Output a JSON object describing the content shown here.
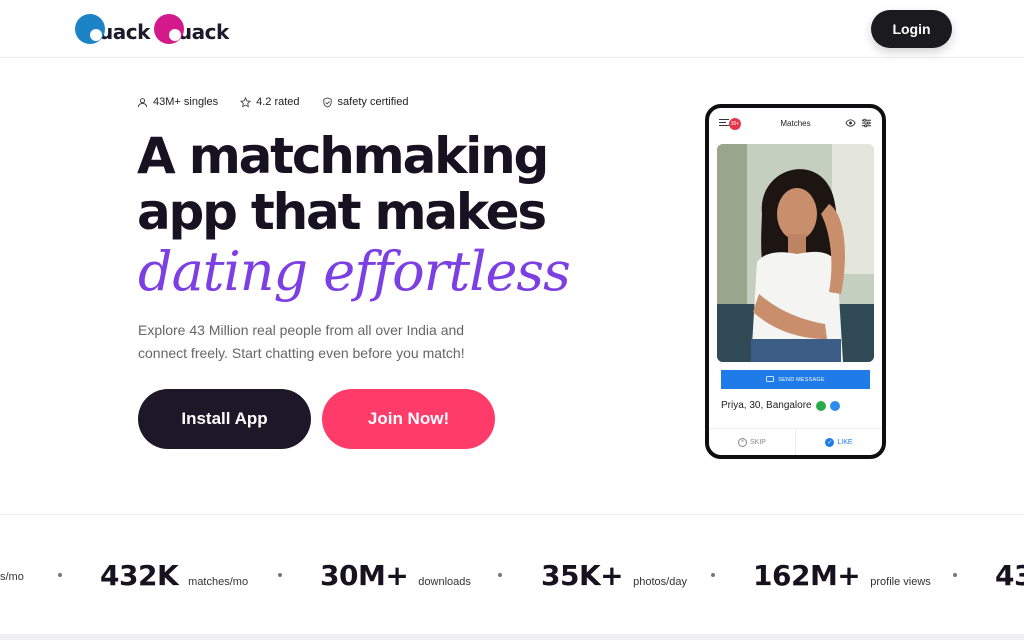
{
  "brand": {
    "logo_word_1": "uack",
    "logo_word_2": "uack",
    "colors": {
      "primary_blue": "#1c84c6",
      "primary_pink": "#d4198a",
      "accent_purple": "#7b3fe4",
      "cta_pink": "#ff3b6a",
      "dark": "#1e1728"
    }
  },
  "header": {
    "login_label": "Login"
  },
  "trust": [
    {
      "icon": "user-icon",
      "label": "43M+ singles"
    },
    {
      "icon": "star-icon",
      "label": "4.2 rated"
    },
    {
      "icon": "shield-check-icon",
      "label": "safety certified"
    }
  ],
  "hero": {
    "headline_line_1": "A matchmaking",
    "headline_line_2": "app that makes",
    "headline_accent": "dating effortless",
    "subtext": "Explore 43 Million real people from all over India and connect freely. Start chatting even before you match!",
    "install_label": "Install App",
    "join_label": "Join Now!"
  },
  "phone": {
    "badge": "30+",
    "title": "Matches",
    "send_message_label": "SEND MESSAGE",
    "profile_name": "Priya, 30, Bangalore",
    "skip_label": "SKIP",
    "like_label": "LIKE"
  },
  "stats": {
    "leading_fragment": "s/mo",
    "items": [
      {
        "number": "432K",
        "label": "matches/mo"
      },
      {
        "number": "30M+",
        "label": "downloads"
      },
      {
        "number": "35K+",
        "label": "photos/day"
      },
      {
        "number": "162M+",
        "label": "profile views"
      }
    ],
    "trailing_fragment": "43"
  }
}
